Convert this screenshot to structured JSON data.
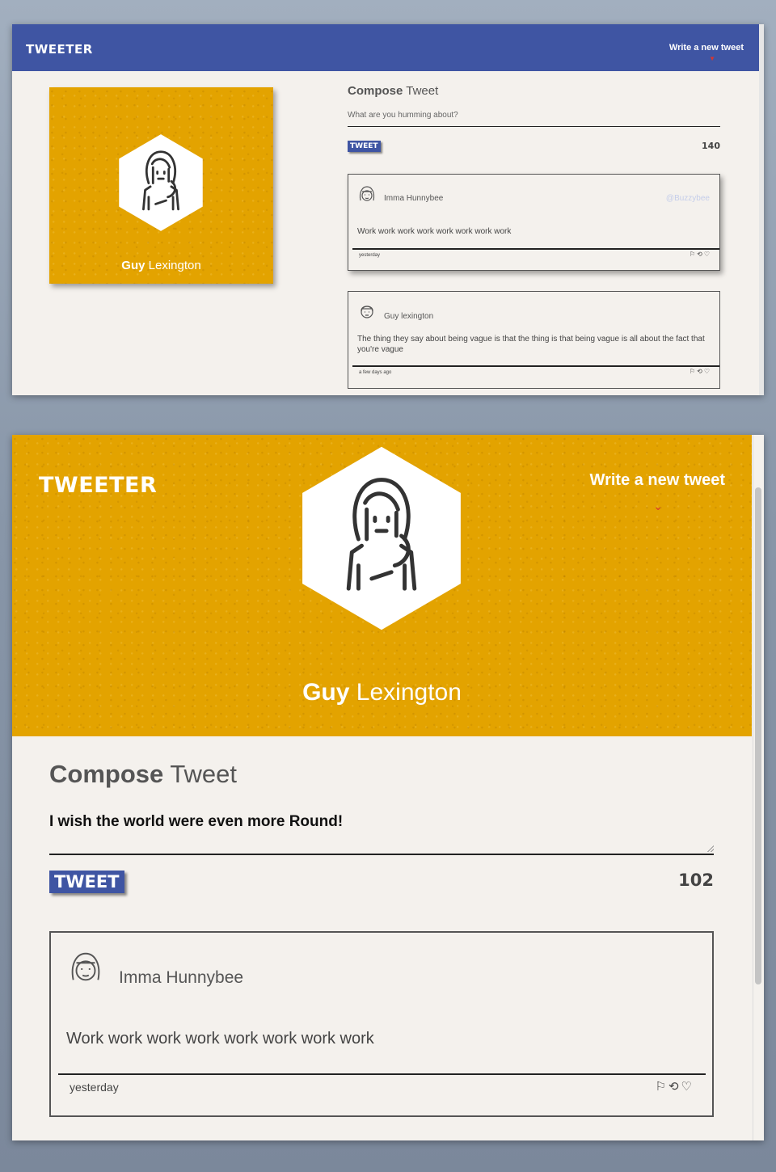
{
  "app": {
    "logo": "TWEETER",
    "write_link": "Write a new tweet",
    "chevron": "»"
  },
  "colors": {
    "nav_bg": "#3f55a3",
    "profile_bg": "#e3a300",
    "accent_red": "#d9352f",
    "handle": "#c4cdea",
    "page_bg": "#f4f1ed"
  },
  "profile": {
    "first_name": "Guy",
    "last_name": "Lexington"
  },
  "compose": {
    "title_bold": "Compose",
    "title_rest": "Tweet",
    "placeholder": "What are you humming about?",
    "typed_value": "I wish the world were even more Round!",
    "button_label": "TWEET",
    "counter_initial": "140",
    "counter_typed": "102"
  },
  "tweets": [
    {
      "user": "Imma Hunnybee",
      "handle": "@Buzzybee",
      "text": "Work work work work work work work work",
      "time": "yesterday",
      "avatar_icon": "girl-avatar-icon"
    },
    {
      "user": "Guy lexington",
      "handle": "",
      "text": "The thing they say about being vague is that the thing is that being vague is all about the fact that you're vague",
      "time": "a few days ago",
      "avatar_icon": "man-avatar-icon"
    }
  ],
  "actions": {
    "flag": "⚐",
    "retweet": "⟲",
    "like": "♡"
  },
  "icons": [
    "flag-icon",
    "retweet-icon",
    "heart-icon",
    "chevron-down-icon",
    "profile-avatar-icon"
  ]
}
